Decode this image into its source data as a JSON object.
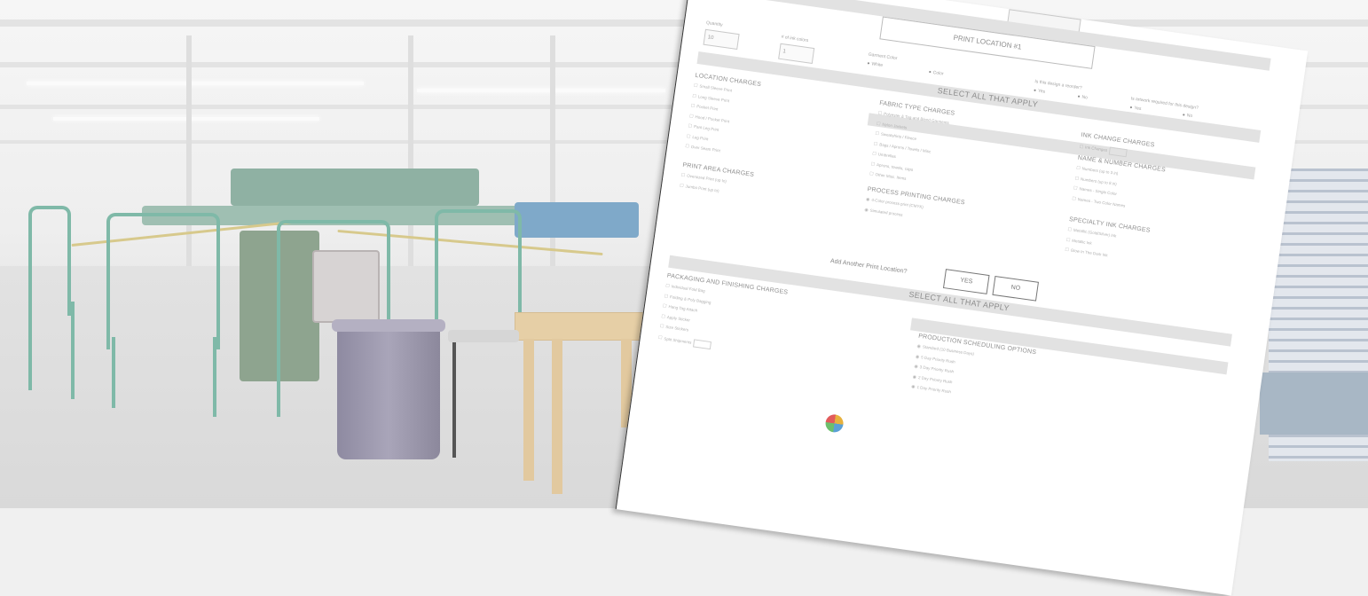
{
  "form": {
    "location_title": "PRINT LOCATION #1",
    "fields": {
      "quantity_label": "Quantity",
      "quantity_value": "10",
      "colors_label": "# of ink colors",
      "colors_value": "1",
      "garment_color_label": "Garment Color",
      "garment_color_opts": [
        "White",
        "Color"
      ],
      "design_label": "Is this design a reorder?",
      "design_opts": [
        "Yes",
        "No"
      ],
      "artwork_label": "Is artwork required for this design?",
      "artwork_opts": [
        "Yes",
        "No"
      ]
    },
    "select_all_1": "SELECT ALL THAT APPLY",
    "location_charges": {
      "title": "LOCATION CHARGES",
      "items": [
        "Small Sleeve Print",
        "Long Sleeve Print",
        "Pocket Print",
        "Hood / Pocket Print",
        "Pant Leg Print",
        "Leg Print",
        "Over Seam Print"
      ]
    },
    "print_area_charges": {
      "title": "PRINT AREA CHARGES",
      "items": [
        "Oversized Print (up to)",
        "Jumbo Print (up to)"
      ]
    },
    "fabric_type_charges": {
      "title": "FABRIC TYPE CHARGES",
      "items": [
        "Polyester & Tag-and Blend Garments",
        "Nylon Jackets",
        "Sweatshirts / Fleece",
        "Bags / Aprons / Towels / Misc",
        "Umbrellas",
        "Aprons, towels, caps",
        "Other Misc. Items"
      ]
    },
    "process_printing_charges": {
      "title": "PROCESS PRINTING CHARGES",
      "items": [
        "4-Color process print (CMYK)",
        "Simulated process"
      ]
    },
    "ink_change_charges": {
      "title": "INK CHANGE CHARGES",
      "items": [
        "Ink Changes"
      ]
    },
    "name_number_charges": {
      "title": "NAME & NUMBER CHARGES",
      "items": [
        "Numbers (up to 3 in)",
        "Numbers (up to 8 in)",
        "Names - Single Color",
        "Names - Two Color Names"
      ]
    },
    "specialty_ink_charges": {
      "title": "SPECIALTY INK CHARGES",
      "items": [
        "Metallic (Gold/Silver) Ink",
        "Metallic Ink",
        "Glow In The Dark Ink"
      ]
    },
    "add_another_label": "Add Another Print Location?",
    "yes_label": "YES",
    "no_label": "NO",
    "select_all_2": "SELECT ALL THAT APPLY",
    "packaging_charges": {
      "title": "PACKAGING AND FINISHING CHARGES",
      "items": [
        "Individual Fold Bag",
        "Folding & Poly Bagging",
        "Hang Tag Attach",
        "Apply Sticker",
        "Size Stickers",
        "Split Shipments"
      ]
    },
    "production_options": {
      "title": "PRODUCTION SCHEDULING OPTIONS",
      "items": [
        "Standard (10 Business Days)",
        "5 Day Priority Rush",
        "3 Day Priority Rush",
        "2 Day Priority Rush",
        "1 Day Priority Rush"
      ]
    }
  },
  "colors": {
    "frame_green": "#7fb9a8",
    "paper": "#ffffff",
    "section_bar": "#e2e2e2"
  }
}
